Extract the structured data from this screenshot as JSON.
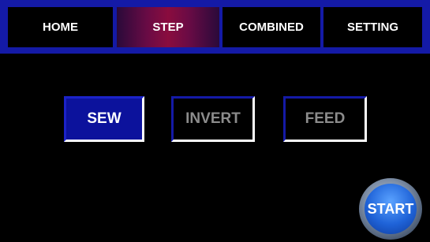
{
  "navbar": {
    "tabs": [
      {
        "label": "HOME",
        "active": false
      },
      {
        "label": "STEP",
        "active": true
      },
      {
        "label": "COMBINED",
        "active": false
      },
      {
        "label": "SETTING",
        "active": false
      }
    ]
  },
  "modes": {
    "sew": {
      "label": "SEW",
      "selected": true
    },
    "invert": {
      "label": "INVERT",
      "selected": false
    },
    "feed": {
      "label": "FEED",
      "selected": false
    }
  },
  "start_button": {
    "label": "START"
  },
  "colors": {
    "background": "#000000",
    "nav_bar": "#141aa6",
    "active_tab": "#8a0c3e",
    "selected_mode": "#0c129c",
    "inactive_text": "#8c8c8c",
    "start": "#1f63d8"
  }
}
